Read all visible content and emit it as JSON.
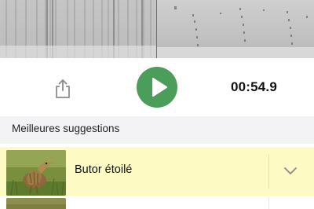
{
  "player": {
    "time": "00:54.9"
  },
  "suggestions": {
    "header": "Meilleures suggestions",
    "items": [
      {
        "label": "Butor étoilé"
      }
    ]
  },
  "colors": {
    "play_button": "#4a9e5a",
    "highlight_row": "#fdfac4",
    "playhead": "#e23b3b"
  },
  "icons": {
    "share": "share-icon",
    "play": "play-icon",
    "chevron": "chevron-down-icon"
  }
}
